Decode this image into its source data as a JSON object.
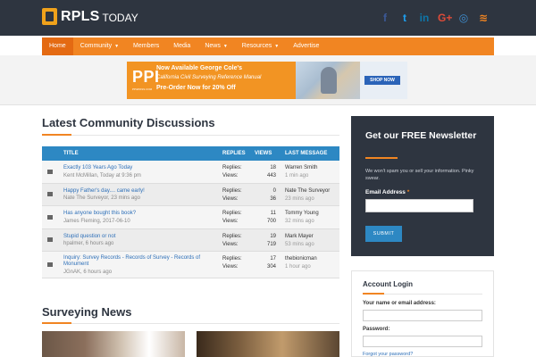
{
  "header": {
    "logo_main": "RPLS",
    "logo_sub": "TODAY",
    "social": [
      {
        "icon": "facebook-icon",
        "glyph": "f",
        "color": "#3b5998"
      },
      {
        "icon": "twitter-icon",
        "glyph": "t",
        "color": "#1da1f2"
      },
      {
        "icon": "linkedin-icon",
        "glyph": "in",
        "color": "#0e76a8"
      },
      {
        "icon": "google-plus-icon",
        "glyph": "G+",
        "color": "#dd4b39"
      },
      {
        "icon": "instagram-icon",
        "glyph": "◎",
        "color": "#3f8fd2"
      },
      {
        "icon": "rss-icon",
        "glyph": "≋",
        "color": "#f18522"
      }
    ]
  },
  "nav": {
    "items": [
      {
        "label": "Home",
        "active": true,
        "caret": false
      },
      {
        "label": "Community",
        "active": false,
        "caret": true
      },
      {
        "label": "Members",
        "active": false,
        "caret": false
      },
      {
        "label": "Media",
        "active": false,
        "caret": false
      },
      {
        "label": "News",
        "active": false,
        "caret": true
      },
      {
        "label": "Resources",
        "active": false,
        "caret": true
      },
      {
        "label": "Advertise",
        "active": false,
        "caret": false
      }
    ]
  },
  "ad": {
    "brand": "PPI",
    "brand_sub": "PPI2PASS.COM",
    "line1": "Now Available George Cole's",
    "line2": "California Civil Surveying Reference Manual",
    "line3": "Pre-Order Now for 20% Off",
    "cta": "SHOP NOW"
  },
  "discussions": {
    "title": "Latest Community Discussions",
    "columns": {
      "title": "TITLE",
      "replies": "REPLIES",
      "views": "VIEWS",
      "last": "LAST MESSAGE"
    },
    "rows": [
      {
        "topic": "Exactly 103 Years Ago Today",
        "meta": "Kent McMillan, Today at 9:36 pm",
        "replies_label": "Replies:",
        "replies": "18",
        "views_label": "Views:",
        "views": "443",
        "last_user": "Warren Smith",
        "last_time": "1 min ago"
      },
      {
        "topic": "Happy Father's day.... came early!",
        "meta": "Nate The Surveyor, 23 mins ago",
        "replies_label": "Replies:",
        "replies": "0",
        "views_label": "Views:",
        "views": "36",
        "last_user": "Nate The Surveyor",
        "last_time": "23 mins ago"
      },
      {
        "topic": "Has anyone bought this book?",
        "meta": "James Fleming, 2017-06-10",
        "replies_label": "Replies:",
        "replies": "11",
        "views_label": "Views:",
        "views": "700",
        "last_user": "Tommy Young",
        "last_time": "32 mins ago"
      },
      {
        "topic": "Stupid question or not",
        "meta": "hpalmer, 6 hours ago",
        "replies_label": "Replies:",
        "replies": "19",
        "views_label": "Views:",
        "views": "719",
        "last_user": "Mark Mayer",
        "last_time": "53 mins ago"
      },
      {
        "topic": "Inquiry: Survey Records - Records of Survey - Records of Monument",
        "meta": "JGnAK, 6 hours ago",
        "replies_label": "Replies:",
        "replies": "17",
        "views_label": "Views:",
        "views": "304",
        "last_user": "thebionicman",
        "last_time": "1 hour ago"
      }
    ]
  },
  "news": {
    "title": "Surveying News"
  },
  "newsletter": {
    "title": "Get our FREE Newsletter",
    "desc": "We won't spam you or sell your information. Pinky swear.",
    "email_label": "Email Address",
    "required_mark": "*",
    "submit": "SUBMIT"
  },
  "login": {
    "title": "Account Login",
    "user_label": "Your name or email address:",
    "pass_label": "Password:",
    "forgot": "Forgot your password?"
  }
}
